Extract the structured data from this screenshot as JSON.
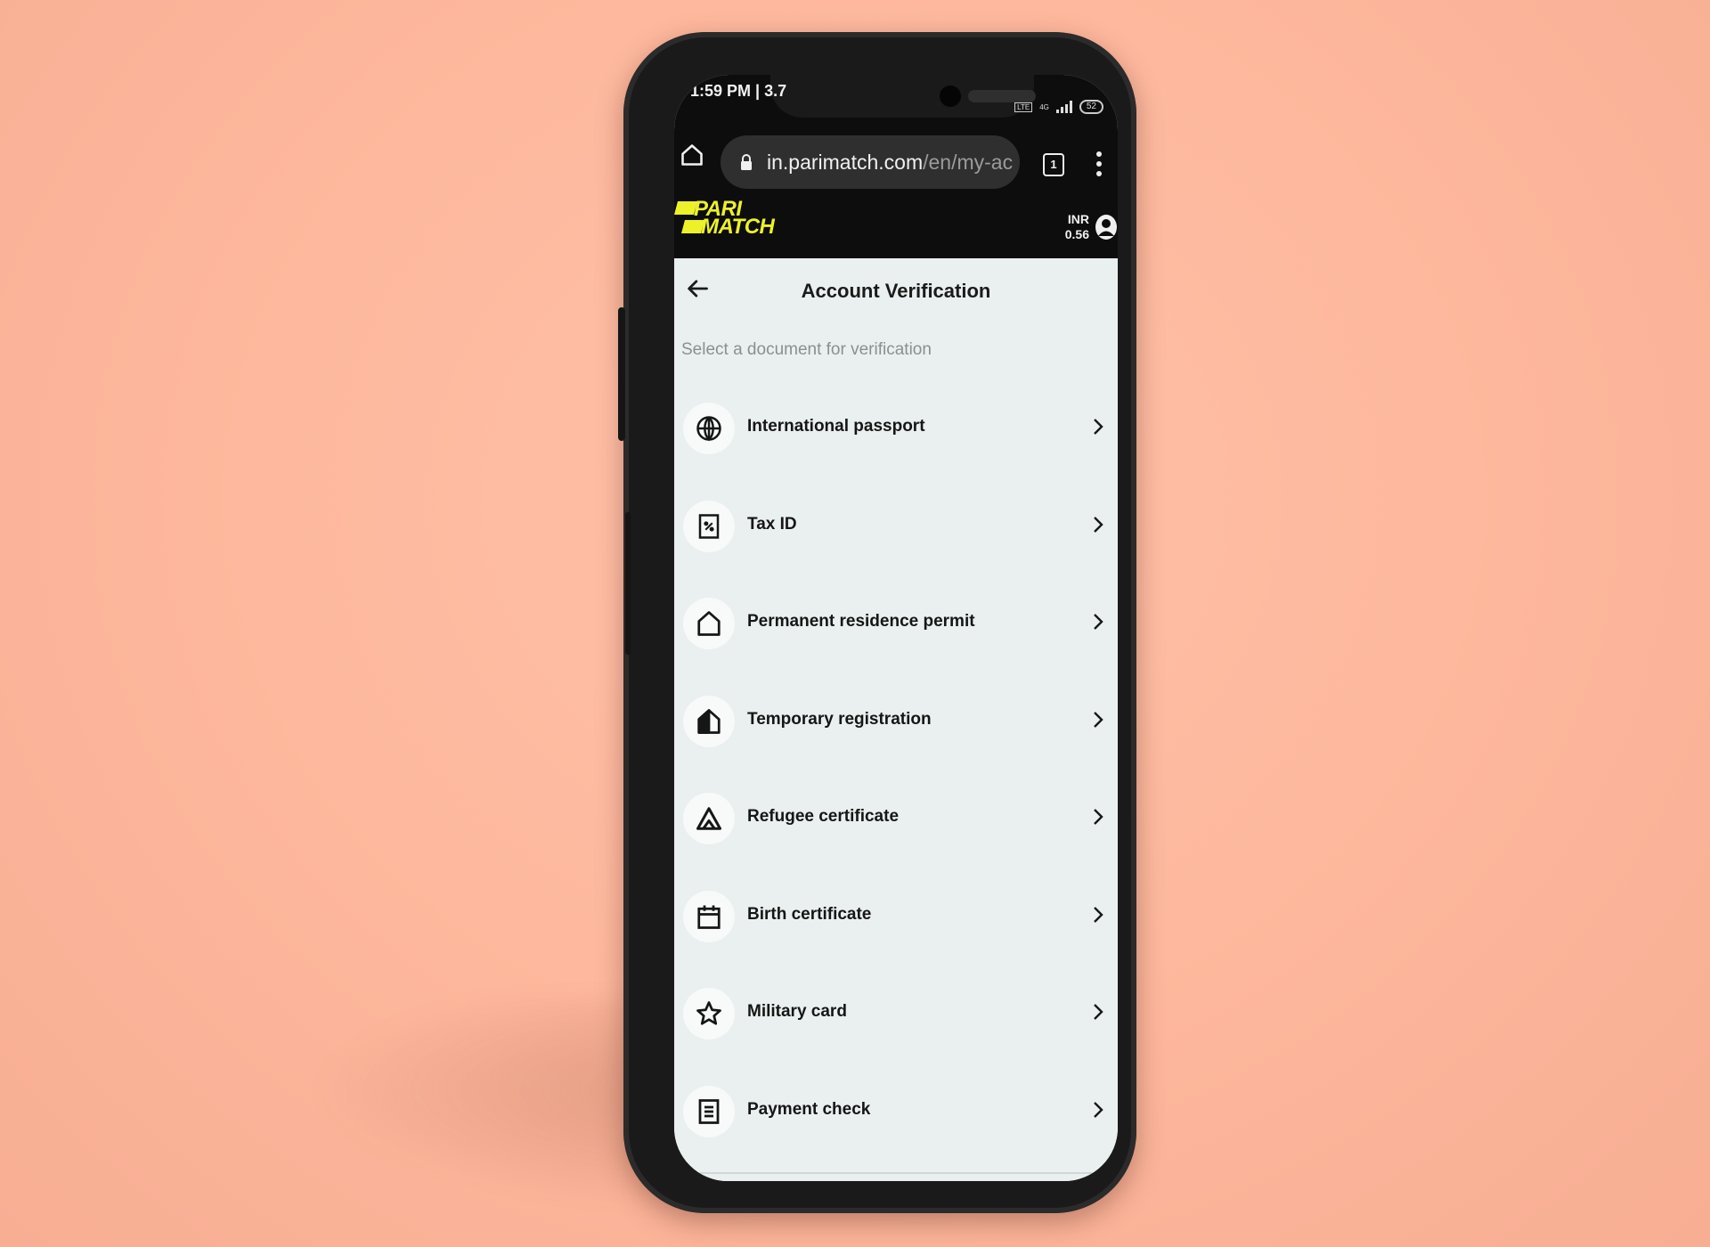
{
  "status_bar": {
    "time": "1:59 PM | 3.7",
    "network": "4G",
    "battery": "52"
  },
  "browser": {
    "url_domain": "in.parimatch.com",
    "url_path": "/en/my-ac",
    "tab_count": "1"
  },
  "header": {
    "logo_line1": "PARI",
    "logo_line2": "MATCH",
    "currency": "INR",
    "balance": "0.56",
    "brand_color": "#ECF12A"
  },
  "page": {
    "title": "Account Verification",
    "subtitle": "Select a document for verification"
  },
  "documents": [
    {
      "label": "International passport",
      "icon": "globe-icon"
    },
    {
      "label": "Tax ID",
      "icon": "tax-document-icon"
    },
    {
      "label": "Permanent residence permit",
      "icon": "house-icon"
    },
    {
      "label": "Temporary registration",
      "icon": "half-house-icon"
    },
    {
      "label": "Refugee certificate",
      "icon": "tent-icon"
    },
    {
      "label": "Birth certificate",
      "icon": "calendar-icon"
    },
    {
      "label": "Military card",
      "icon": "star-icon"
    },
    {
      "label": "Payment check",
      "icon": "receipt-icon"
    }
  ]
}
